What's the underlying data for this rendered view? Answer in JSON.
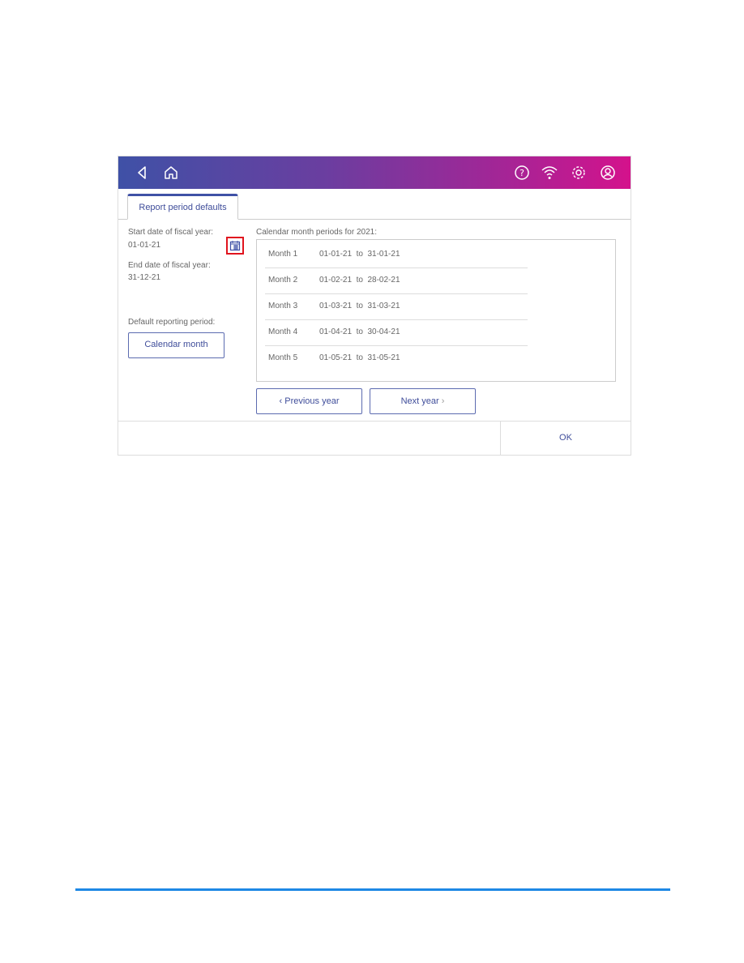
{
  "header": {
    "icons": [
      "back-icon",
      "home-icon",
      "help-icon",
      "wifi-icon",
      "settings-icon",
      "account-icon"
    ],
    "gradient": [
      "#3f51a6",
      "#d4128c"
    ]
  },
  "tab": {
    "label": "Report period defaults"
  },
  "left": {
    "start_label": "Start date of fiscal year:",
    "start_value": "01-01-21",
    "end_label": "End date of fiscal year:",
    "end_value": "31-12-21",
    "period_label": "Default reporting period:",
    "period_button": "Calendar month"
  },
  "periods": {
    "title": "Calendar month periods for  2021:",
    "rows": [
      {
        "month": "Month 1",
        "range": "01-01-21  to  31-01-21"
      },
      {
        "month": "Month 2",
        "range": "01-02-21  to  28-02-21"
      },
      {
        "month": "Month 3",
        "range": "01-03-21  to  31-03-21"
      },
      {
        "month": "Month 4",
        "range": "01-04-21  to  30-04-21"
      },
      {
        "month": "Month 5",
        "range": "01-05-21  to  31-05-21"
      }
    ]
  },
  "nav": {
    "prev": "Previous year",
    "next": "Next year"
  },
  "footer": {
    "ok": "OK"
  },
  "highlight_color": "#e0141e"
}
